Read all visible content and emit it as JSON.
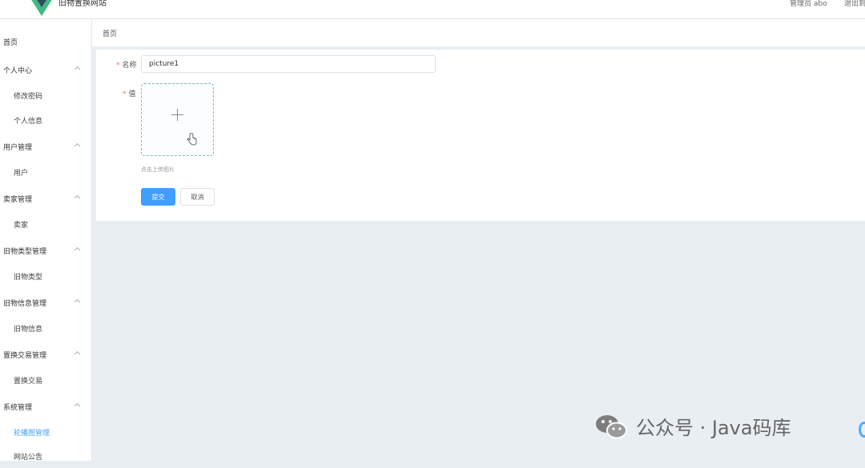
{
  "header": {
    "site_title": "旧物置换网站",
    "admin_label": "管理员 abo",
    "logout_label": "退出到"
  },
  "sidebar": {
    "items": [
      {
        "label": "首页",
        "type": "top"
      },
      {
        "label": "个人中心",
        "type": "group"
      },
      {
        "label": "修改密码",
        "type": "sub"
      },
      {
        "label": "个人信息",
        "type": "sub"
      },
      {
        "label": "用户管理",
        "type": "group"
      },
      {
        "label": "用户",
        "type": "sub"
      },
      {
        "label": "卖家管理",
        "type": "group"
      },
      {
        "label": "卖家",
        "type": "sub"
      },
      {
        "label": "旧物类型管理",
        "type": "group"
      },
      {
        "label": "旧物类型",
        "type": "sub"
      },
      {
        "label": "旧物信息管理",
        "type": "group"
      },
      {
        "label": "旧物信息",
        "type": "sub"
      },
      {
        "label": "置换交易管理",
        "type": "group"
      },
      {
        "label": "置换交易",
        "type": "sub"
      },
      {
        "label": "系统管理",
        "type": "group"
      },
      {
        "label": "轮播图管理",
        "type": "sub",
        "active": true
      },
      {
        "label": "网站公告",
        "type": "sub"
      }
    ]
  },
  "breadcrumb": {
    "current": "首页"
  },
  "form": {
    "name_label": "名称",
    "name_value": "picture1",
    "value_label": "值",
    "upload_tip": "点击上传图片",
    "submit_label": "提交",
    "cancel_label": "取消"
  },
  "watermark": {
    "text": "公众号 · Java码库"
  },
  "colors": {
    "primary": "#409eff",
    "required": "#f56c6c",
    "logo_green": "#42b983",
    "logo_dark": "#35495e",
    "background": "#e9eef3"
  },
  "icons": {
    "upload": "plus-icon",
    "cursor": "hand-pointer-icon",
    "expand": "chevron-up-icon",
    "watermark": "wechat-icon"
  }
}
